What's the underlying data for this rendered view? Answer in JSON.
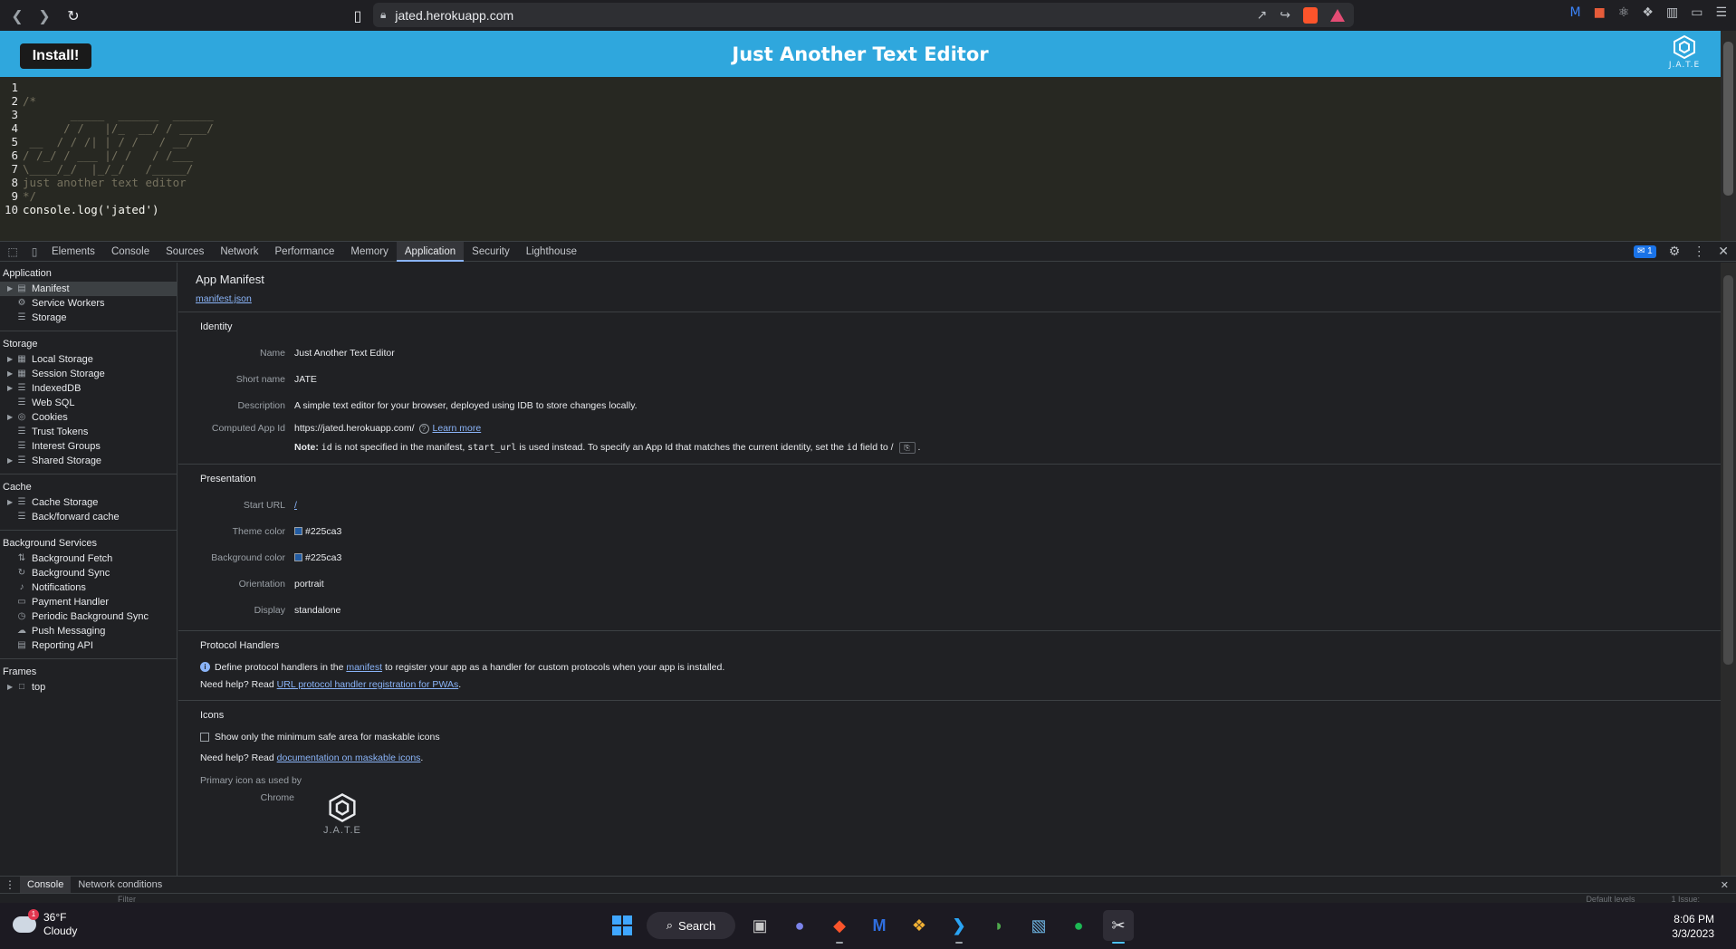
{
  "browser": {
    "url": "jated.herokuapp.com"
  },
  "app": {
    "install_label": "Install!",
    "title": "Just Another Text Editor",
    "logo_caption": "J.A.T.E",
    "brand_color": "#2fa7dd"
  },
  "editor": {
    "lines": [
      {
        "n": "1",
        "text": "",
        "kind": "plain"
      },
      {
        "n": "2",
        "text": "/*",
        "kind": "cm"
      },
      {
        "n": "3",
        "text": "       _____  ______  ______",
        "kind": "cm"
      },
      {
        "n": "4",
        "text": "      / /   |/_  __/ / ____/",
        "kind": "cm"
      },
      {
        "n": "5",
        "text": " __  / / /| | / /   / __/",
        "kind": "cm"
      },
      {
        "n": "6",
        "text": "/ /_/ / ___ |/ /   / /___",
        "kind": "cm"
      },
      {
        "n": "7",
        "text": "\\____/_/  |_/_/   /_____/",
        "kind": "cm"
      },
      {
        "n": "8",
        "text": "just another text editor",
        "kind": "cm"
      },
      {
        "n": "9",
        "text": "*/",
        "kind": "cm"
      },
      {
        "n": "10",
        "text": "console.log('jated')",
        "kind": "code"
      }
    ]
  },
  "devtools": {
    "tabs": [
      "Elements",
      "Console",
      "Sources",
      "Network",
      "Performance",
      "Memory",
      "Application",
      "Security",
      "Lighthouse"
    ],
    "active_tab": "Application",
    "issues_count": "1",
    "sidebar": {
      "application": {
        "title": "Application",
        "items": [
          {
            "label": "Manifest",
            "icon": "file-icon",
            "arrow": true,
            "selected": true
          },
          {
            "label": "Service Workers",
            "icon": "gear-icon",
            "arrow": false
          },
          {
            "label": "Storage",
            "icon": "database-icon",
            "arrow": false
          }
        ]
      },
      "storage": {
        "title": "Storage",
        "items": [
          {
            "label": "Local Storage",
            "icon": "grid-icon",
            "arrow": true
          },
          {
            "label": "Session Storage",
            "icon": "grid-icon",
            "arrow": true
          },
          {
            "label": "IndexedDB",
            "icon": "database-icon",
            "arrow": true
          },
          {
            "label": "Web SQL",
            "icon": "database-icon",
            "arrow": false
          },
          {
            "label": "Cookies",
            "icon": "cookie-icon",
            "arrow": true
          },
          {
            "label": "Trust Tokens",
            "icon": "database-icon",
            "arrow": false
          },
          {
            "label": "Interest Groups",
            "icon": "database-icon",
            "arrow": false
          },
          {
            "label": "Shared Storage",
            "icon": "database-icon",
            "arrow": true
          }
        ]
      },
      "cache": {
        "title": "Cache",
        "items": [
          {
            "label": "Cache Storage",
            "icon": "database-icon",
            "arrow": true
          },
          {
            "label": "Back/forward cache",
            "icon": "database-icon",
            "arrow": false
          }
        ]
      },
      "background": {
        "title": "Background Services",
        "items": [
          {
            "label": "Background Fetch",
            "icon": "updown-icon",
            "arrow": false
          },
          {
            "label": "Background Sync",
            "icon": "sync-icon",
            "arrow": false
          },
          {
            "label": "Notifications",
            "icon": "bell-icon",
            "arrow": false
          },
          {
            "label": "Payment Handler",
            "icon": "card-icon",
            "arrow": false
          },
          {
            "label": "Periodic Background Sync",
            "icon": "clock-icon",
            "arrow": false
          },
          {
            "label": "Push Messaging",
            "icon": "cloud-icon",
            "arrow": false
          },
          {
            "label": "Reporting API",
            "icon": "file-icon",
            "arrow": false
          }
        ]
      },
      "frames": {
        "title": "Frames",
        "items": [
          {
            "label": "top",
            "icon": "frame-icon",
            "arrow": true
          }
        ]
      }
    },
    "manifest": {
      "title": "App Manifest",
      "file_link": "manifest.json",
      "identity": {
        "title": "Identity",
        "name_label": "Name",
        "name": "Just Another Text Editor",
        "short_name_label": "Short name",
        "short_name": "JATE",
        "description_label": "Description",
        "description": "A simple text editor for your browser, deployed using IDB to store changes locally.",
        "app_id_label": "Computed App Id",
        "app_id": "https://jated.herokuapp.com/",
        "learn_more": "Learn more",
        "note_bold": "Note:",
        "note_code_1": "id",
        "note_text_1": "is not specified in the manifest,",
        "note_code_2": "start_url",
        "note_text_2": "is used instead. To specify an App Id that matches the current identity, set the",
        "note_code_3": "id",
        "note_text_3": "field to",
        "note_value": "/",
        "note_end": "."
      },
      "presentation": {
        "title": "Presentation",
        "start_url_label": "Start URL",
        "start_url": "/",
        "theme_color_label": "Theme color",
        "theme_color": "#225ca3",
        "bg_color_label": "Background color",
        "bg_color": "#225ca3",
        "orientation_label": "Orientation",
        "orientation": "portrait",
        "display_label": "Display",
        "display": "standalone"
      },
      "protocol": {
        "title": "Protocol Handlers",
        "text_1": "Define protocol handlers in the",
        "link_1": "manifest",
        "text_2": "to register your app as a handler for custom protocols when your app is installed.",
        "help_prefix": "Need help? Read",
        "help_link": "URL protocol handler registration for PWAs",
        "help_end": "."
      },
      "icons": {
        "title": "Icons",
        "checkbox_label": "Show only the minimum safe area for maskable icons",
        "help_prefix": "Need help? Read",
        "help_link": "documentation on maskable icons",
        "help_end": ".",
        "primary_label": "Primary icon as used by",
        "chrome_label": "Chrome",
        "icon_caption": "J.A.T.E"
      }
    },
    "drawer": {
      "tabs": [
        "Console",
        "Network conditions"
      ],
      "active_tab": "Console",
      "filter_placeholder": "Filter",
      "levels": "Default levels",
      "issue": "1 Issue:"
    }
  },
  "taskbar": {
    "weather_temp": "36°F",
    "weather_desc": "Cloudy",
    "weather_badge": "1",
    "search_label": "Search",
    "time": "8:06 PM",
    "date": "3/3/2023"
  }
}
